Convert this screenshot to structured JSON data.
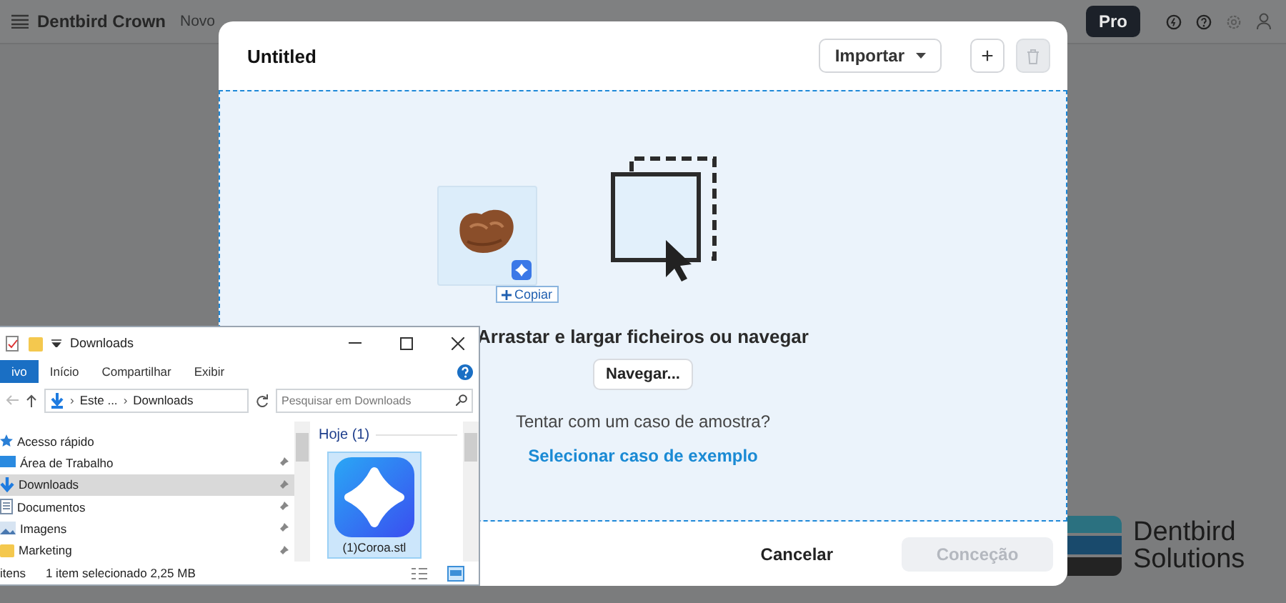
{
  "app_bar": {
    "title": "Dentbird Crown",
    "menu": [
      "Novo"
    ],
    "pro_button": "Pro"
  },
  "dialog": {
    "title": "Untitled",
    "import_button": "Importar",
    "add_button": "+",
    "delete_disabled": true,
    "dropzone": {
      "heading": "Arrastar e largar ficheiros ou navegar",
      "browse_button": "Navegar...",
      "prompt": "Tentar com um caso de amostra?",
      "sample_link": "Selecionar caso de exemplo"
    },
    "cancel_button": "Cancelar",
    "confirm_button": {
      "label": "Conceção",
      "disabled": true
    }
  },
  "drag_preview": {
    "badge": "Copiar"
  },
  "explorer": {
    "title": "Downloads",
    "ribbon_tabs": [
      {
        "label": "ivo",
        "selected": true
      },
      {
        "label": "Início",
        "selected": false
      },
      {
        "label": "Compartilhar",
        "selected": false
      },
      {
        "label": "Exibir",
        "selected": false
      }
    ],
    "breadcrumb": [
      "Este ...",
      "Downloads"
    ],
    "breadcrumb_separator": "›",
    "search_placeholder": "Pesquisar em Downloads",
    "nav": [
      {
        "kind": "star",
        "label": "Acesso rápido",
        "selected": false,
        "pinned": false
      },
      {
        "kind": "desktop",
        "label": "Área de Trabalho",
        "selected": false,
        "pinned": true
      },
      {
        "kind": "download",
        "label": "Downloads",
        "selected": true,
        "pinned": true
      },
      {
        "kind": "document",
        "label": "Documentos",
        "selected": false,
        "pinned": true
      },
      {
        "kind": "image",
        "label": "Imagens",
        "selected": false,
        "pinned": true
      },
      {
        "kind": "folder",
        "label": "Marketing",
        "selected": false,
        "pinned": true
      }
    ],
    "group": "Hoje (1)",
    "files": [
      {
        "name": "(1)Coroa.stl",
        "selected": true
      }
    ],
    "status": [
      "itens",
      "1 item selecionado  2,25 MB"
    ]
  },
  "logo": {
    "line1": "Dentbird",
    "line2": "Solutions"
  }
}
